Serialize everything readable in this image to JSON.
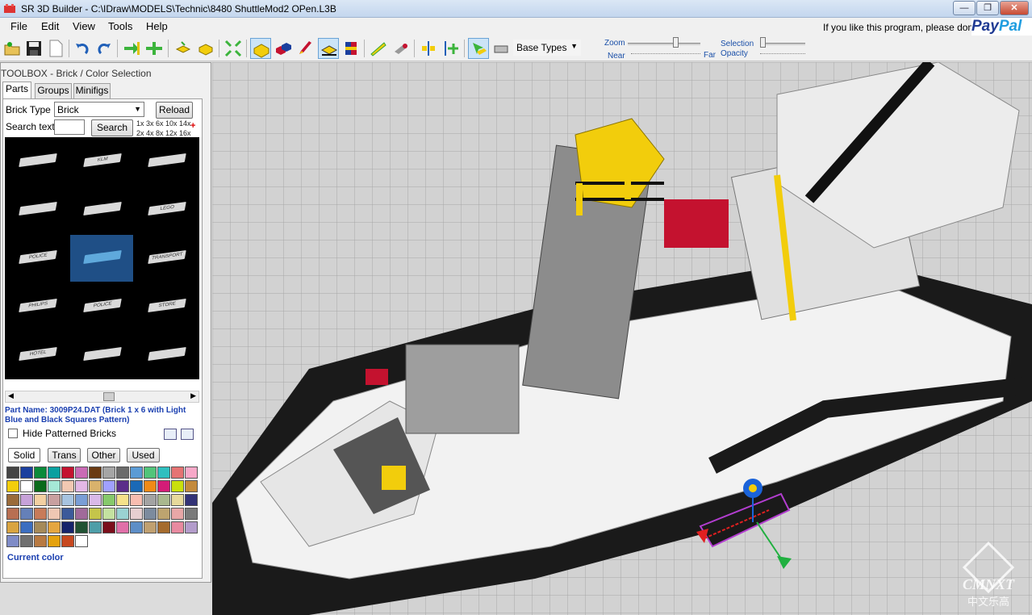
{
  "window": {
    "title": "SR 3D Builder - C:\\IDraw\\MODELS\\Technic\\8480 ShuttleMod2 OPen.L3B",
    "minimize": "—",
    "maximize": "❐",
    "close": "✕"
  },
  "menu": {
    "items": [
      "File",
      "Edit",
      "View",
      "Tools",
      "Help"
    ],
    "donate_text": "If you like this program, please donate",
    "paypal_a": "Pay",
    "paypal_b": "Pal"
  },
  "toolbar": {
    "base_types": "Base Types",
    "zoom": "Zoom",
    "near": "Near",
    "far": "Far",
    "selection": "Selection",
    "opacity": "Opacity",
    "zoom_level": 0.65,
    "opacity_level": 0.05
  },
  "toolbox": {
    "title": "TOOLBOX - Brick / Color Selection",
    "tabs": [
      "Parts",
      "Groups",
      "Minifigs"
    ],
    "brick_type_label": "Brick Type",
    "brick_type_value": "Brick",
    "reload": "Reload",
    "search_label": "Search text",
    "search_value": "",
    "search_button": "Search",
    "sizes_row1": "1x  3x  6x  10x  14x",
    "sizes_row2": "2x  4x  8x  12x  16x",
    "bricks": [
      "",
      "KLM",
      "",
      "",
      "",
      "LEGO",
      "POLICE",
      "",
      "TRANSPORT",
      "PHILIPS",
      "POLICE",
      "STORE",
      "HOTEL",
      "",
      ""
    ],
    "part_name": "Part Name: 3009P24.DAT (Brick  1 x  6 with Light Blue and Black Squares Pattern)",
    "hide_patterned": "Hide Patterned Bricks",
    "color_tabs": [
      "Solid",
      "Trans",
      "Other",
      "Used"
    ],
    "current_color": "Current color",
    "palette": [
      "#444444",
      "#1b3f9e",
      "#0b8a3a",
      "#0aa0a0",
      "#c4122f",
      "#c96bb5",
      "#6a3b13",
      "#a5a5a5",
      "#6b6b6b",
      "#5b9bd5",
      "#52c47a",
      "#2fbfbf",
      "#e57373",
      "#f7a8c8",
      "#f2cd0c",
      "#ffffff",
      "#0a6a1a",
      "#a5e8d7",
      "#f2c8b2",
      "#e3b8e6",
      "#d9b26c",
      "#a0a0ff",
      "#5b2d8a",
      "#1b69b6",
      "#f08a17",
      "#d41c77",
      "#c9e00d",
      "#c48a3b",
      "#9a6b3a",
      "#c7a2d9",
      "#f3d0a2",
      "#c9a0a0",
      "#a7c4e0",
      "#7a9ed6",
      "#d9b9e8",
      "#86c96b",
      "#f5e28a",
      "#f8bdb0",
      "#a3a3a3",
      "#a9b88e",
      "#e7d99b",
      "#333377",
      "#b86f52",
      "#6580b8",
      "#c87b59",
      "#efc7b3",
      "#3b5a9a",
      "#a06a9a",
      "#c5c54a",
      "#c4e2a0",
      "#9ad3d3",
      "#e6cfd0",
      "#7c8b9e",
      "#bda46f",
      "#e8a7a7",
      "#7a7a7a",
      "#d9a440",
      "#3c6ec0",
      "#a58a5a",
      "#e5a640",
      "#15236b",
      "#215233",
      "#4e9ea8",
      "#7a0e1a",
      "#e06fa8",
      "#5d8ec7",
      "#c0a070",
      "#a56b2d",
      "#e88aa0",
      "#b39ccb",
      "#7f8cc7",
      "#707070",
      "#b87a42",
      "#e5a20f",
      "#c7481f",
      "#ffffff"
    ]
  }
}
